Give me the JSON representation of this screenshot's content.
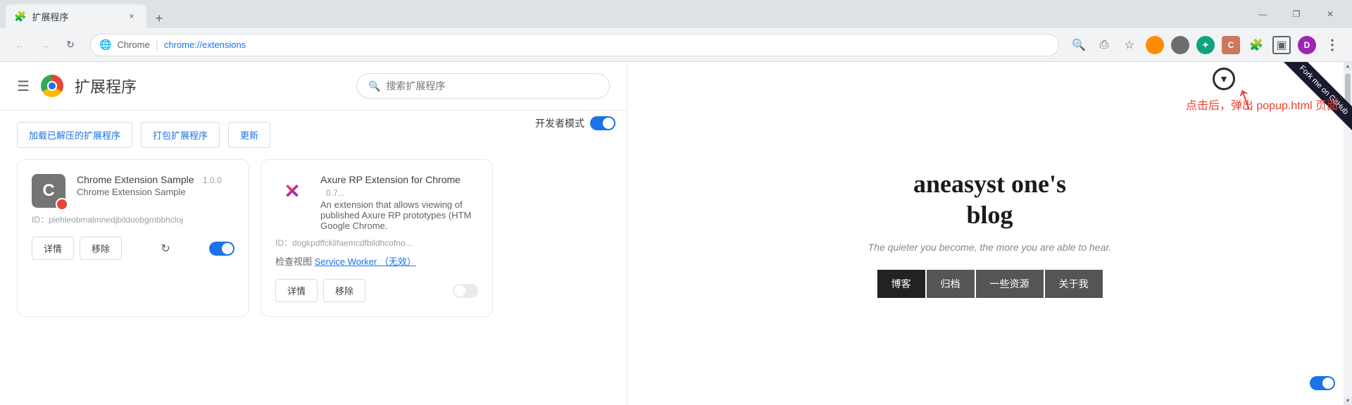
{
  "titlebar": {
    "tab_title": "扩展程序",
    "tab_close": "×",
    "new_tab": "+",
    "minimize": "—",
    "restore": "❐",
    "close": "✕"
  },
  "navbar": {
    "back": "←",
    "forward": "→",
    "reload": "↻",
    "site_icon": "🌐",
    "chrome_label": "Chrome",
    "separator": "|",
    "url": "chrome://extensions",
    "search_icon": "🔍",
    "share_icon": "⎙",
    "star_icon": "☆",
    "extensions_icon": "🧩",
    "menu_icon": "⋮"
  },
  "extensions_page": {
    "hamburger": "☰",
    "logo_text": "C",
    "title": "扩展程序",
    "search_placeholder": "搜索扩展程序",
    "load_btn": "加载已解压的扩展程序",
    "pack_btn": "打包扩展程序",
    "update_btn": "更新",
    "dev_mode_label": "开发者模式",
    "cards": [
      {
        "icon": "C",
        "name": "Chrome Extension Sample",
        "version": "1.0.0",
        "desc": "Chrome Extension Sample",
        "id": "ID：piehleobmalmnedjbildoobgmbbhcloj",
        "details_btn": "详情",
        "remove_btn": "移除",
        "enabled": true
      },
      {
        "icon": "X",
        "name": "Axure RP Extension for Chrome",
        "version": "0.7...",
        "desc": "An extension that allows viewing of published Axure RP prototypes (HTM Google Chrome.",
        "id": "ID：dogkpdffcklifaemcdfbildhcofno...",
        "service_worker": "Service Worker （无效）",
        "inspect_label": "检查视图",
        "details_btn": "详情",
        "remove_btn": "移除",
        "enabled": false
      }
    ]
  },
  "blog": {
    "fork_ribbon": "Fork me on GitHub",
    "title": "aneasyst one's\nblog",
    "title_line1": "aneasyst one's",
    "title_line2": "blog",
    "subtitle": "The quieter you become, the more you are able to hear.",
    "nav_items": [
      "博客",
      "归档",
      "一些资源",
      "关于我"
    ]
  },
  "annotation": {
    "circle_arrow": "▼",
    "label": "点击后，弹出 popup.html 页面"
  }
}
